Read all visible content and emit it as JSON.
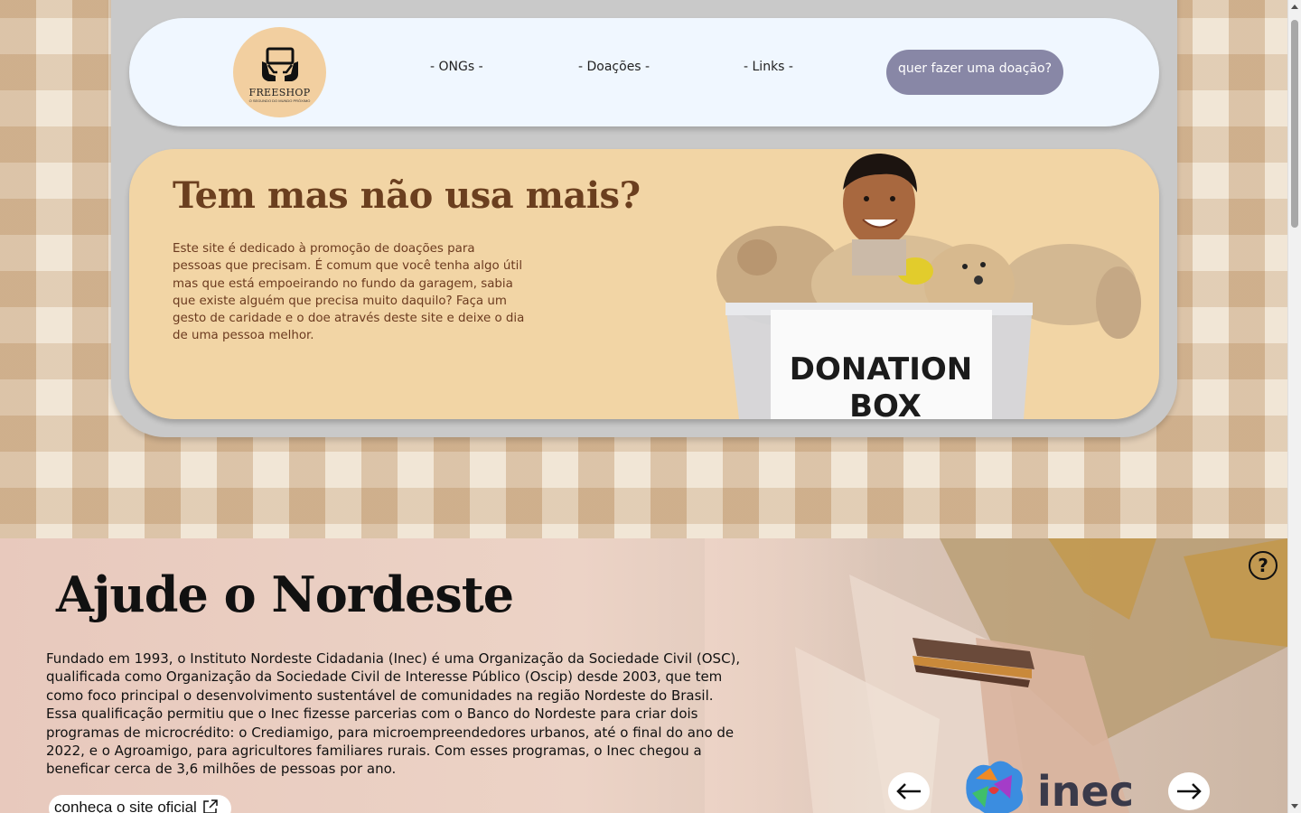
{
  "header": {
    "logo": {
      "name": "FREESHOP",
      "tagline": "O SEGUNDO DO MUNDO PRÓXIMO"
    },
    "nav": [
      {
        "label": "- ONGs -"
      },
      {
        "label": "- Doações -"
      },
      {
        "label": "- Links -"
      }
    ],
    "cta_label": "quer fazer uma doação?"
  },
  "hero": {
    "title": "Tem mas não usa mais?",
    "text": "Este site é dedicado à promoção de doações para pessoas que precisam. É comum que você tenha algo útil mas que está empoeirando no fundo da garagem, sabia que existe alguém que precisa muito daquilo? Faça um gesto de caridade e o doe através deste site e deixe o dia de uma pessoa melhor.",
    "image_text_line1": "DONATION",
    "image_text_line2": "BOX"
  },
  "ong_section": {
    "title": "Ajude o Nordeste",
    "text": "Fundado em 1993, o Instituto Nordeste Cidadania (Inec) é uma Organização da Sociedade Civil (OSC), qualificada como Organização da Sociedade Civil de Interesse Público (Oscip) desde 2003, que tem como foco principal o desenvolvimento sustentável de comunidades na região Nordeste do Brasil. Essa qualificação permitiu que o Inec fizesse parcerias com o Banco do Nordeste para criar dois programas de microcrédito: o Crediamigo, para microempreendedores urbanos, até o final do ano de 2022, e o Agroamigo, para agricultores familiares rurais. Com esses programas, o Inec chegou a beneficar cerca de 3,6 milhões de pessoas por ano.",
    "link_label": "conheça o site oficial",
    "help_label": "?",
    "logo_text": "inec"
  },
  "colors": {
    "navbar_bg": "#f0f7ff",
    "cta_bg": "#8887a6",
    "hero_bg": "#f2d5a5",
    "hero_title": "#6b3f1f",
    "frame_bg": "#c9c9c9"
  },
  "icons": [
    "logo-hands-icon",
    "help-icon",
    "external-link-icon",
    "arrow-left-icon",
    "arrow-right-icon"
  ]
}
